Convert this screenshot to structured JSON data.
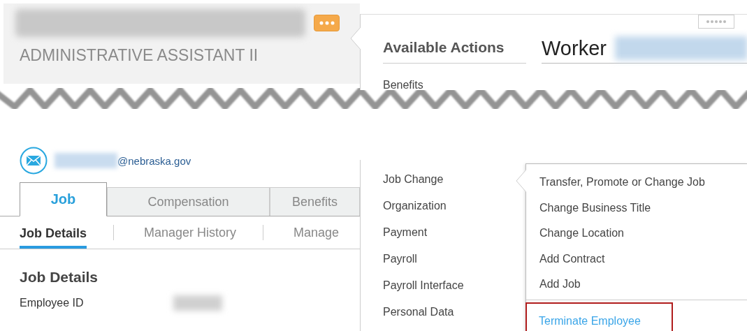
{
  "header": {
    "title": "ADMINISTRATIVE ASSISTANT II"
  },
  "actions_popup": {
    "heading": "Available Actions",
    "worker_label": "Worker",
    "items_upper": [
      {
        "label": "Benefits"
      }
    ],
    "items_lower": [
      {
        "label": "Job Change"
      },
      {
        "label": "Organization"
      },
      {
        "label": "Payment"
      },
      {
        "label": "Payroll"
      },
      {
        "label": "Payroll Interface"
      },
      {
        "label": "Personal Data"
      }
    ]
  },
  "submenu": {
    "items": [
      {
        "label": "Transfer, Promote or Change Job",
        "highlighted": false
      },
      {
        "label": "Change Business Title",
        "highlighted": false
      },
      {
        "label": "Change Location",
        "highlighted": false
      },
      {
        "label": "Add Contract",
        "highlighted": false
      },
      {
        "label": "Add Job",
        "highlighted": false
      },
      {
        "label": "Terminate Employee",
        "highlighted": true
      }
    ]
  },
  "email": {
    "domain": "@nebraska.gov"
  },
  "tabs": [
    {
      "label": "Job",
      "selected": true
    },
    {
      "label": "Compensation",
      "selected": false
    },
    {
      "label": "Benefits",
      "selected": false
    }
  ],
  "subtabs": [
    {
      "label": "Job Details",
      "selected": true
    },
    {
      "label": "Manager History",
      "selected": false
    },
    {
      "label": "Manage",
      "selected": false
    }
  ],
  "section": {
    "title": "Job Details",
    "fields": [
      {
        "label": "Employee ID"
      }
    ]
  }
}
